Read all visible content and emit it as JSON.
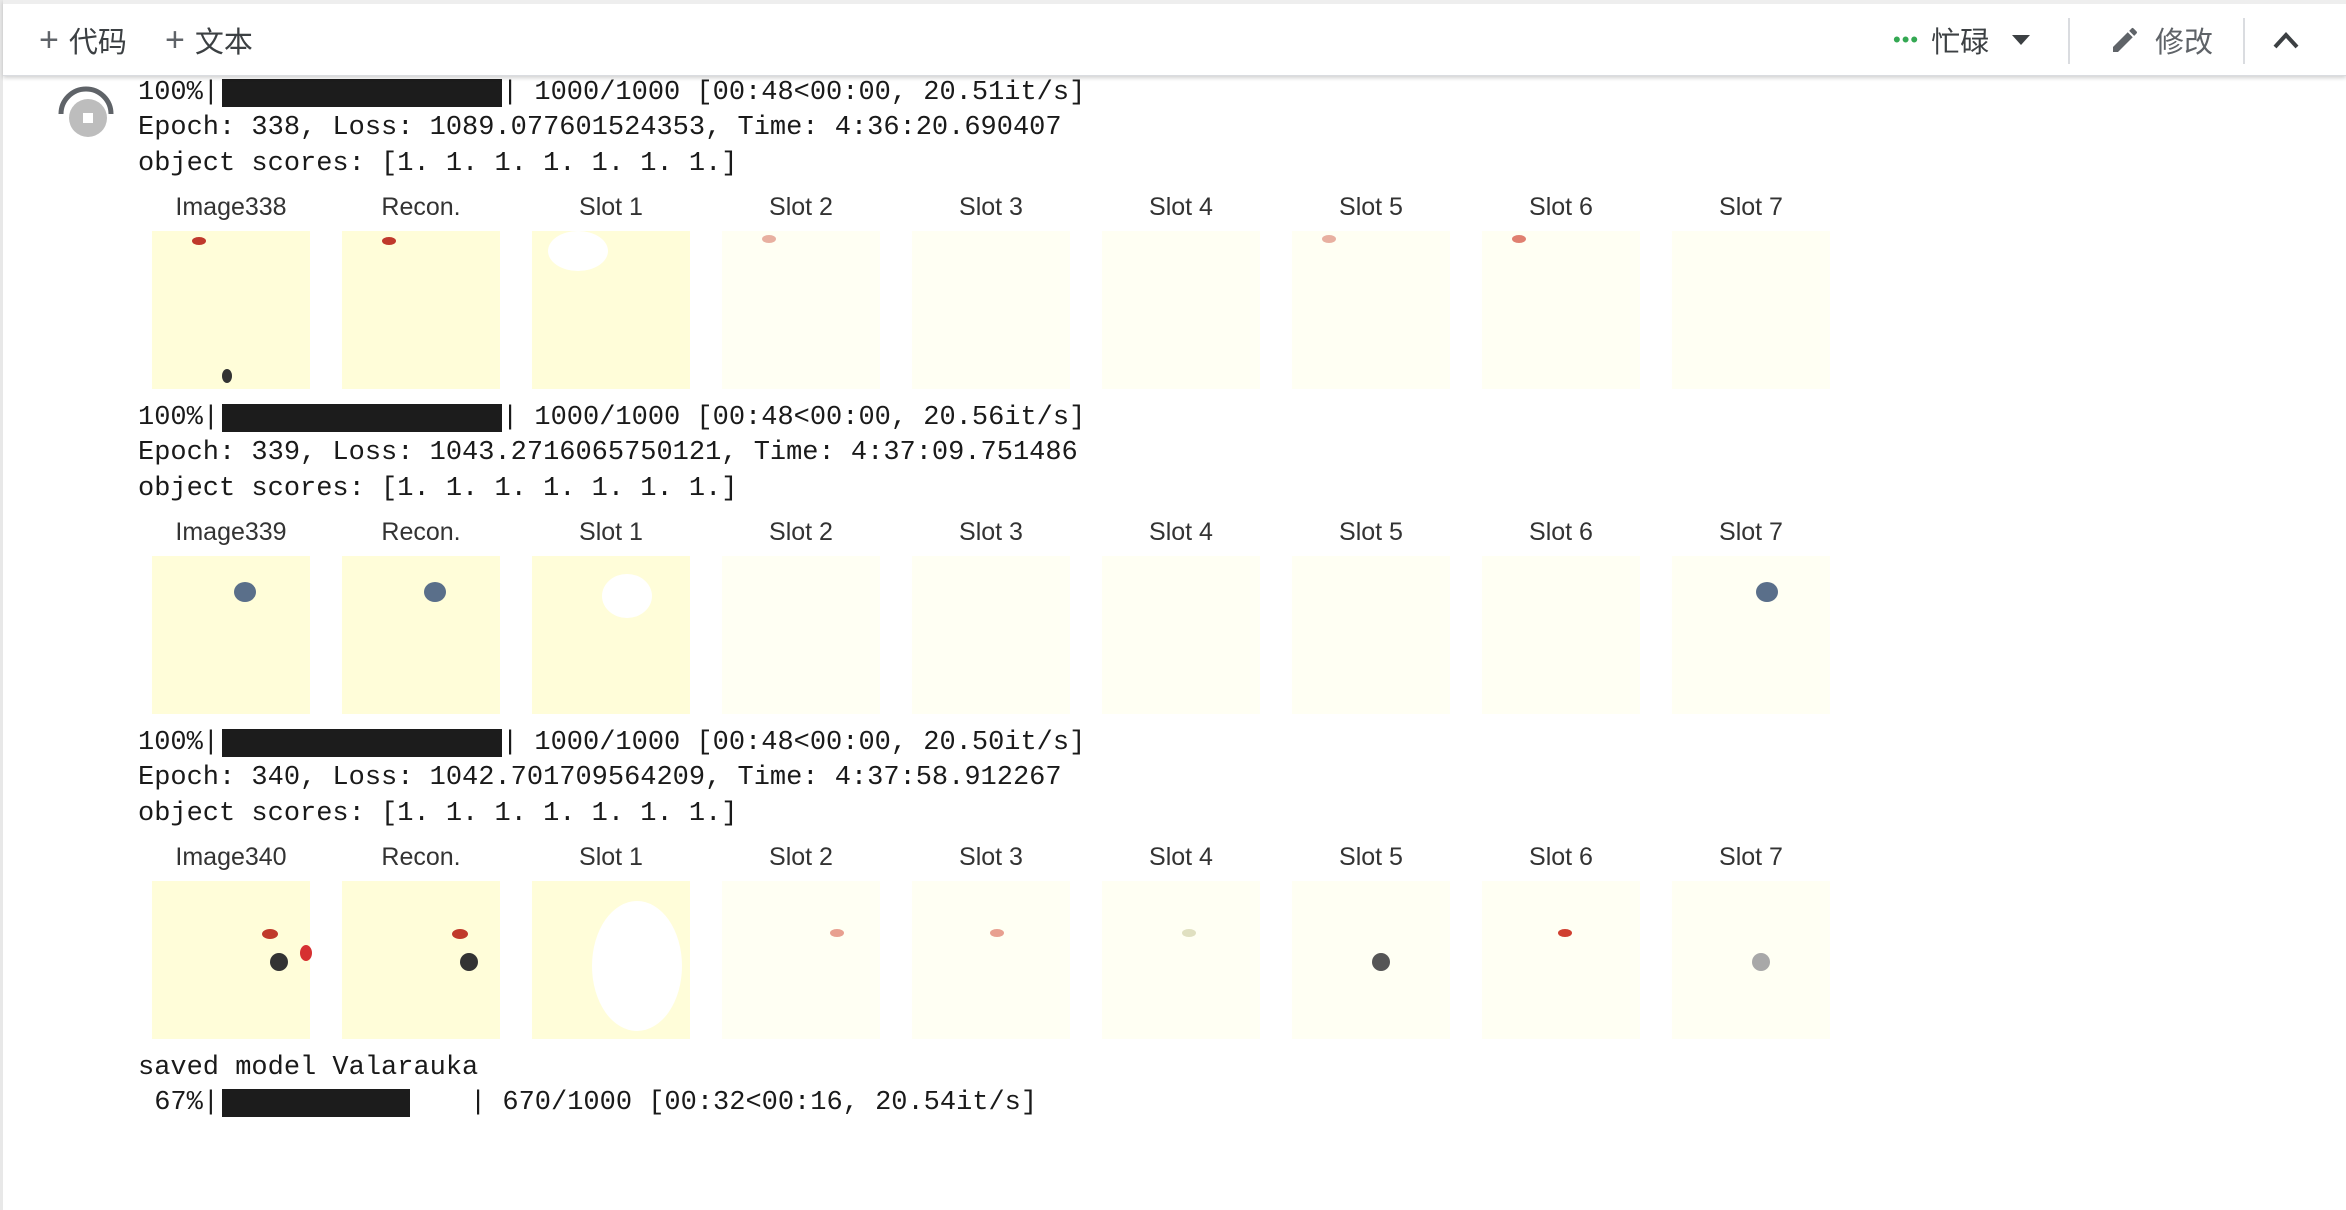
{
  "toolbar": {
    "add_code": "代码",
    "add_text": "文本",
    "status": "忙碌",
    "edit": "修改"
  },
  "output": {
    "epochs": [
      {
        "progress": "100%|",
        "progress_value": 1.0,
        "progress_stats": "| 1000/1000 [00:48<00:00, 20.51it/s]",
        "epoch_line": "Epoch: 338, Loss: 1089.077601524353, Time: 4:36:20.690407",
        "scores_line": "object scores: [1. 1. 1. 1. 1. 1. 1.]",
        "panels": [
          "Image338",
          "Recon.",
          "Slot 1",
          "Slot 2",
          "Slot 3",
          "Slot 4",
          "Slot 5",
          "Slot 6",
          "Slot 7"
        ]
      },
      {
        "progress": "100%|",
        "progress_value": 1.0,
        "progress_stats": "| 1000/1000 [00:48<00:00, 20.56it/s]",
        "epoch_line": "Epoch: 339, Loss: 1043.2716065750121, Time: 4:37:09.751486",
        "scores_line": "object scores: [1. 1. 1. 1. 1. 1. 1.]",
        "panels": [
          "Image339",
          "Recon.",
          "Slot 1",
          "Slot 2",
          "Slot 3",
          "Slot 4",
          "Slot 5",
          "Slot 6",
          "Slot 7"
        ]
      },
      {
        "progress": "100%|",
        "progress_value": 1.0,
        "progress_stats": "| 1000/1000 [00:48<00:00, 20.50it/s]",
        "epoch_line": "Epoch: 340, Loss: 1042.701709564209, Time: 4:37:58.912267",
        "scores_line": "object scores: [1. 1. 1. 1. 1. 1. 1.]",
        "panels": [
          "Image340",
          "Recon.",
          "Slot 1",
          "Slot 2",
          "Slot 3",
          "Slot 4",
          "Slot 5",
          "Slot 6",
          "Slot 7"
        ]
      }
    ],
    "saved_line": "saved model Valarauka",
    "final_progress": {
      "percent": " 67%|",
      "progress_value": 0.67,
      "stats": "| 670/1000 [00:32<00:16, 20.54it/s]"
    }
  }
}
